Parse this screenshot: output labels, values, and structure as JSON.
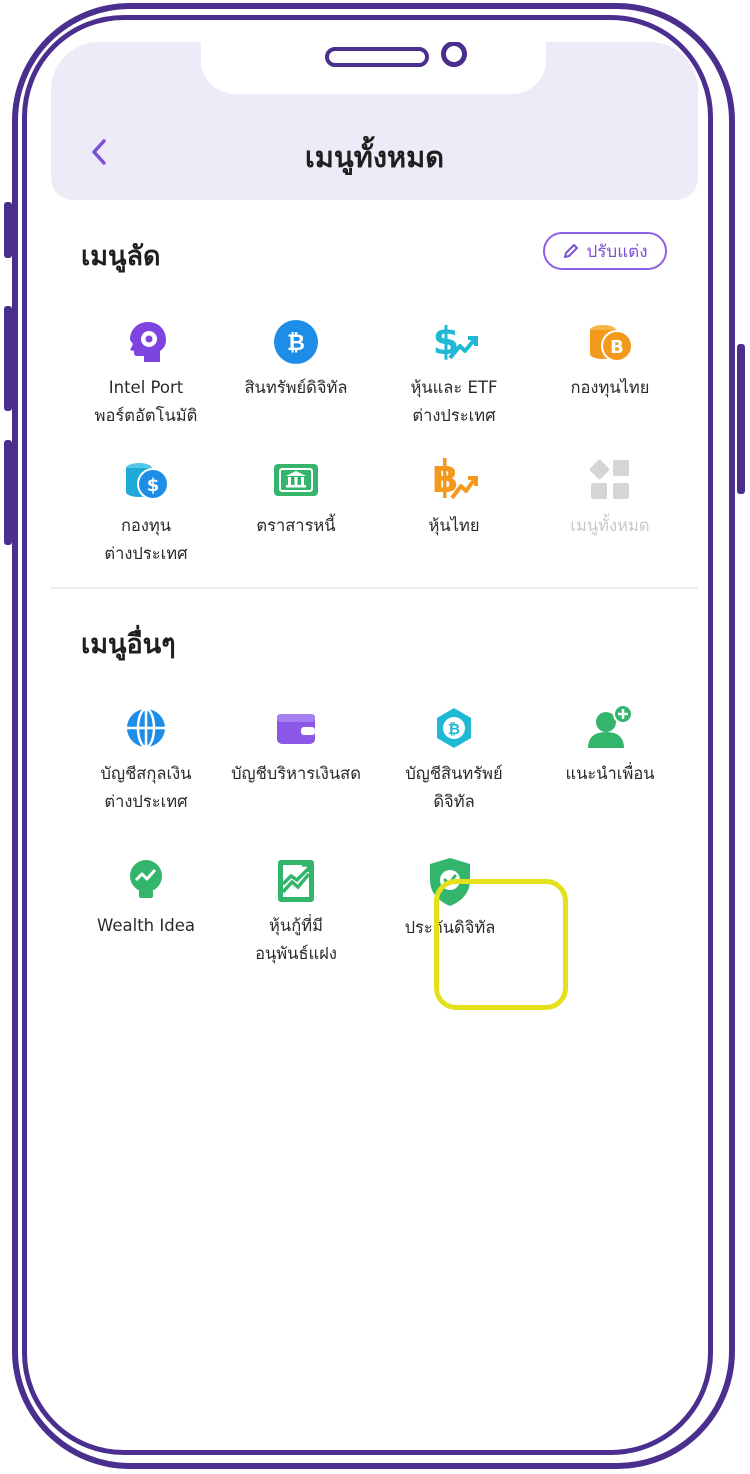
{
  "header": {
    "title": "เมนูทั้งหมด",
    "back_icon": "chevron-left-icon"
  },
  "shortcut": {
    "title": "เมนูลัด",
    "edit_label": "ปรับแต่ง",
    "items": [
      {
        "lines": [
          "Intel Port",
          "พอร์ตอัตโนมัติ"
        ],
        "icon": "brain-gear-icon",
        "color": "#7e44e0"
      },
      {
        "lines": [
          "สินทรัพย์ดิจิทัล",
          ""
        ],
        "icon": "bitcoin-icon",
        "color": "#1e8de8"
      },
      {
        "lines": [
          "หุ้นและ ETF",
          "ต่างประเทศ"
        ],
        "icon": "dollar-trend-icon",
        "color": "#1fb9d6"
      },
      {
        "lines": [
          "กองทุนไทย",
          ""
        ],
        "icon": "baht-coins-icon",
        "color": "#f39a1d"
      },
      {
        "lines": [
          "กองทุน",
          "ต่างประเทศ"
        ],
        "icon": "dollar-coins-icon",
        "color": "#1ea9d9"
      },
      {
        "lines": [
          "ตราสารหนี้",
          ""
        ],
        "icon": "bond-icon",
        "color": "#33b56b"
      },
      {
        "lines": [
          "หุ้นไทย",
          ""
        ],
        "icon": "baht-trend-icon",
        "color": "#f39a1d"
      },
      {
        "lines": [
          "เมนูทั้งหมด",
          ""
        ],
        "icon": "grid-icon",
        "color": "#d5d5d5"
      }
    ]
  },
  "other": {
    "title": "เมนูอื่นๆ",
    "items": [
      {
        "lines": [
          "บัญชีสกุลเงิน",
          "ต่างประเทศ"
        ],
        "icon": "globe-icon",
        "color": "#1e8de8"
      },
      {
        "lines": [
          "บัญชีบริหารเงินสด",
          ""
        ],
        "icon": "wallet-icon",
        "color": "#8a57e6"
      },
      {
        "lines": [
          "บัญชีสินทรัพย์",
          "ดิจิทัล"
        ],
        "icon": "hex-bitcoin-icon",
        "color": "#1fb9d6"
      },
      {
        "lines": [
          "แนะนำเพื่อน",
          ""
        ],
        "icon": "add-friend-icon",
        "color": "#33b56b"
      },
      {
        "lines": [
          "Wealth Idea",
          ""
        ],
        "icon": "idea-bulb-icon",
        "color": "#33b56b"
      },
      {
        "lines": [
          "หุ้นกู้ที่มี",
          "อนุพันธ์แฝง"
        ],
        "icon": "structured-note-icon",
        "color": "#33b56b"
      },
      {
        "lines": [
          "ประกันดิจิทัล",
          ""
        ],
        "icon": "shield-check-icon",
        "color": "#33b56b"
      }
    ]
  }
}
